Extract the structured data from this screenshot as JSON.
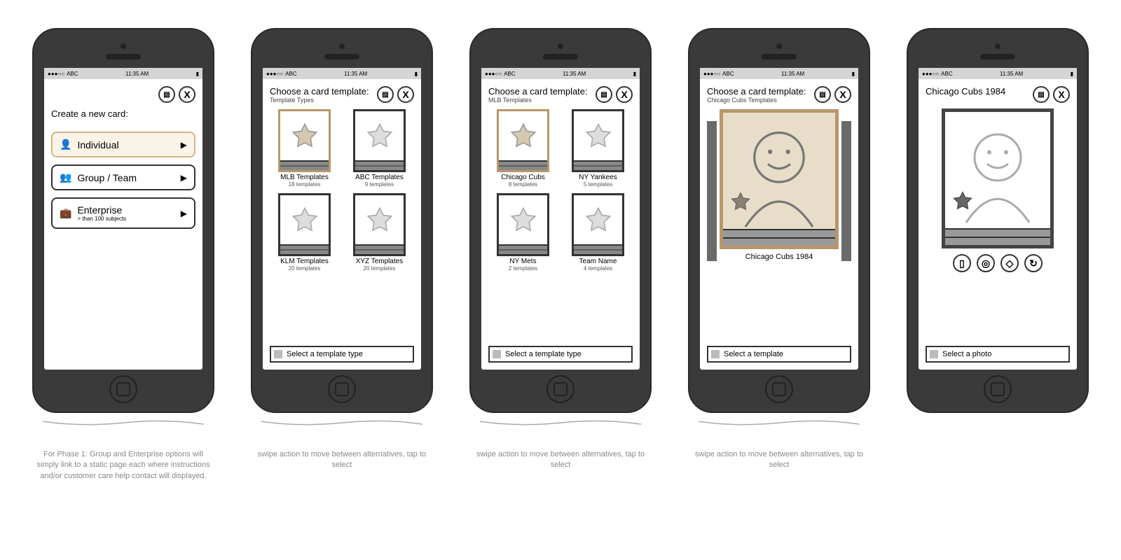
{
  "status": {
    "signal": "●●●○○",
    "carrier": "ABC",
    "time": "11:35 AM",
    "battery": "▮"
  },
  "s1": {
    "title": "Create a new card:",
    "opt1": "Individual",
    "opt2": "Group / Team",
    "opt3": "Enterprise",
    "opt3_sub": "> than 100 subjects",
    "annotation": "For Phase 1: Group and Enterprise options will simply link to a static page each where instructions and/or customer care help contact will displayed."
  },
  "s2": {
    "title": "Choose a card template:",
    "subtitle": "Template Types",
    "t1": "MLB Templates",
    "t1s": "18 templates",
    "t2": "ABC Templates",
    "t2s": "9 templates",
    "t3": "KLM Templates",
    "t3s": "20 templates",
    "t4": "XYZ Templates",
    "t4s": "20 templates",
    "button": "Select a template type",
    "annotation": "swipe action to move between alternatives, tap to select"
  },
  "s3": {
    "title": "Choose a card template:",
    "subtitle": "MLB Templates",
    "t1": "Chicago Cubs",
    "t1s": "8 templates",
    "t2": "NY Yankees",
    "t2s": "5 templates",
    "t3": "NY Mets",
    "t3s": "2 templates",
    "t4": "Team Name",
    "t4s": "4 templates",
    "button": "Select a template type",
    "annotation": "swipe action to move between alternatives, tap to select"
  },
  "s4": {
    "title": "Choose a card template:",
    "subtitle": "Chicago Cubs Templates",
    "caption": "Chicago Cubs 1984",
    "button": "Select a template",
    "annotation": "swipe action to move between alternatives, tap to select"
  },
  "s5": {
    "title": "Chicago Cubs 1984",
    "button": "Select a photo"
  }
}
